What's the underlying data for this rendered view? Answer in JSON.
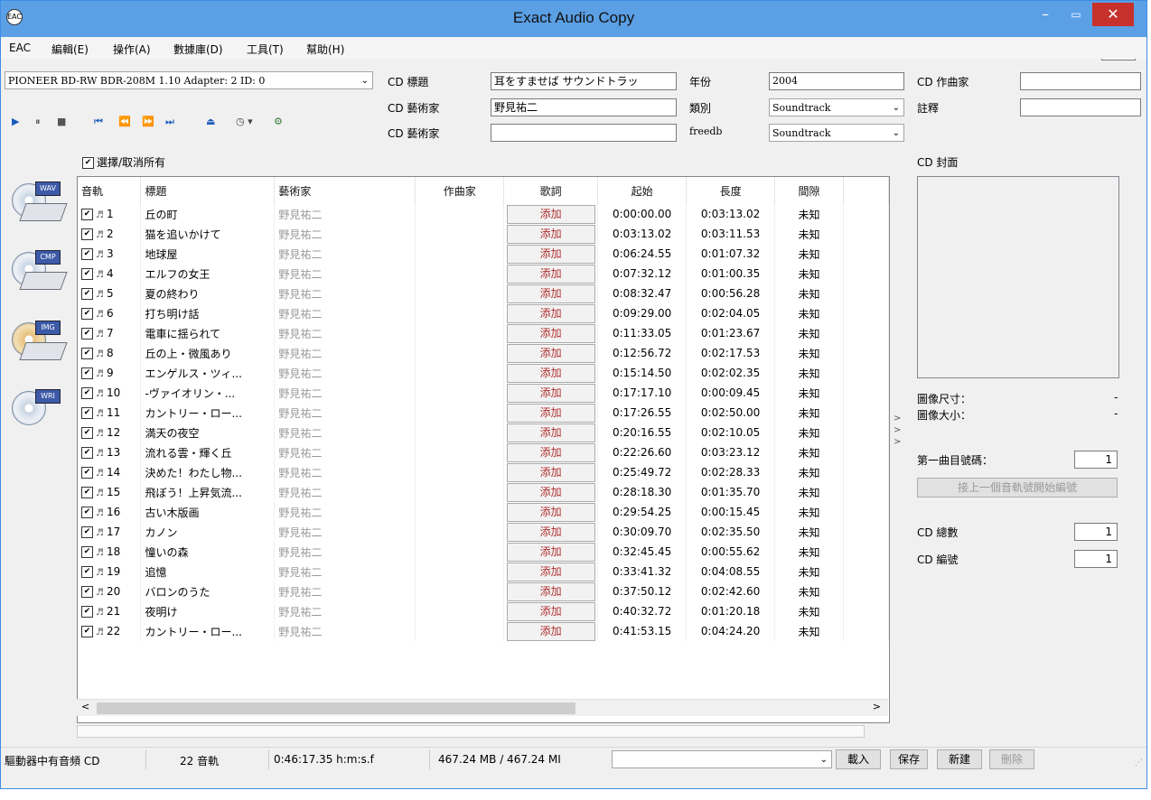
{
  "window": {
    "title": "Exact Audio Copy",
    "app_icon": "EAC",
    "tooltip": "關閉"
  },
  "menu": [
    "EAC",
    "編輯(E)",
    "操作(A)",
    "數據庫(D)",
    "工具(T)",
    "幫助(H)"
  ],
  "drive": {
    "selected": "PIONEER BD-RW   BDR-208M 1.10  Adapter: 2  ID: 0"
  },
  "cd_info": {
    "title_label": "CD 標題",
    "title_value": "耳をすませば サウンドトラッ",
    "artist_label": "CD 藝術家",
    "artist_value": "野見祐二",
    "artist2_label": "CD 藝術家",
    "artist2_value": "",
    "year_label": "年份",
    "year_value": "2004",
    "genre_label": "類別",
    "genre_value": "Soundtrack",
    "freedb_label": "freedb",
    "freedb_value": "Soundtrack",
    "composer_label": "CD 作曲家",
    "composer_value": "",
    "comment_label": "註釋",
    "comment_value": ""
  },
  "select_all_label": "選擇/取消所有",
  "sidebar_icons": [
    "WAV",
    "CMP",
    "IMG",
    "WRI"
  ],
  "table": {
    "headers": [
      "音軌",
      "標題",
      "藝術家",
      "作曲家",
      "歌詞",
      "起始",
      "長度",
      "間隙"
    ],
    "add_label": "添加",
    "rows": [
      {
        "no": "1",
        "title": "丘の町",
        "artist": "野見祐二",
        "start": "0:00:00.00",
        "len": "0:03:13.02",
        "gap": "未知"
      },
      {
        "no": "2",
        "title": "猫を追いかけて",
        "artist": "野見祐二",
        "start": "0:03:13.02",
        "len": "0:03:11.53",
        "gap": "未知"
      },
      {
        "no": "3",
        "title": "地球屋",
        "artist": "野見祐二",
        "start": "0:06:24.55",
        "len": "0:01:07.32",
        "gap": "未知"
      },
      {
        "no": "4",
        "title": "エルフの女王",
        "artist": "野見祐二",
        "start": "0:07:32.12",
        "len": "0:01:00.35",
        "gap": "未知"
      },
      {
        "no": "5",
        "title": "夏の終わり",
        "artist": "野見祐二",
        "start": "0:08:32.47",
        "len": "0:00:56.28",
        "gap": "未知"
      },
      {
        "no": "6",
        "title": "打ち明け話",
        "artist": "野見祐二",
        "start": "0:09:29.00",
        "len": "0:02:04.05",
        "gap": "未知"
      },
      {
        "no": "7",
        "title": "電車に揺られて",
        "artist": "野見祐二",
        "start": "0:11:33.05",
        "len": "0:01:23.67",
        "gap": "未知"
      },
      {
        "no": "8",
        "title": "丘の上・微風あり",
        "artist": "野見祐二",
        "start": "0:12:56.72",
        "len": "0:02:17.53",
        "gap": "未知"
      },
      {
        "no": "9",
        "title": "エンゲルス・ツィ...",
        "artist": "野見祐二",
        "start": "0:15:14.50",
        "len": "0:02:02.35",
        "gap": "未知"
      },
      {
        "no": "10",
        "title": "-ヴァイオリン・...",
        "artist": "野見祐二",
        "start": "0:17:17.10",
        "len": "0:00:09.45",
        "gap": "未知"
      },
      {
        "no": "11",
        "title": "カントリー・ロー...",
        "artist": "野見祐二",
        "start": "0:17:26.55",
        "len": "0:02:50.00",
        "gap": "未知"
      },
      {
        "no": "12",
        "title": "満天の夜空",
        "artist": "野見祐二",
        "start": "0:20:16.55",
        "len": "0:02:10.05",
        "gap": "未知"
      },
      {
        "no": "13",
        "title": "流れる雲・輝く丘",
        "artist": "野見祐二",
        "start": "0:22:26.60",
        "len": "0:03:23.12",
        "gap": "未知"
      },
      {
        "no": "14",
        "title": "決めた！わたし物...",
        "artist": "野見祐二",
        "start": "0:25:49.72",
        "len": "0:02:28.33",
        "gap": "未知"
      },
      {
        "no": "15",
        "title": "飛ぼう！上昇気流...",
        "artist": "野見祐二",
        "start": "0:28:18.30",
        "len": "0:01:35.70",
        "gap": "未知"
      },
      {
        "no": "16",
        "title": "古い木版画",
        "artist": "野見祐二",
        "start": "0:29:54.25",
        "len": "0:00:15.45",
        "gap": "未知"
      },
      {
        "no": "17",
        "title": "カノン",
        "artist": "野見祐二",
        "start": "0:30:09.70",
        "len": "0:02:35.50",
        "gap": "未知"
      },
      {
        "no": "18",
        "title": "憧いの森",
        "artist": "野見祐二",
        "start": "0:32:45.45",
        "len": "0:00:55.62",
        "gap": "未知"
      },
      {
        "no": "19",
        "title": "追憶",
        "artist": "野見祐二",
        "start": "0:33:41.32",
        "len": "0:04:08.55",
        "gap": "未知"
      },
      {
        "no": "20",
        "title": "バロンのうた",
        "artist": "野見祐二",
        "start": "0:37:50.12",
        "len": "0:02:42.60",
        "gap": "未知"
      },
      {
        "no": "21",
        "title": "夜明け",
        "artist": "野見祐二",
        "start": "0:40:32.72",
        "len": "0:01:20.18",
        "gap": "未知"
      },
      {
        "no": "22",
        "title": "カントリー・ロー...",
        "artist": "野見祐二",
        "start": "0:41:53.15",
        "len": "0:04:24.20",
        "gap": "未知"
      }
    ]
  },
  "right_panel": {
    "cover_label": "CD 封面",
    "image_size_label": "圖像尺寸：",
    "image_size_value": "-",
    "image_bytes_label": "圖像大小：",
    "image_bytes_value": "-",
    "first_track_label": "第一曲目號碼：",
    "first_track_value": "1",
    "continue_button": "接上一個音軌號開始編號",
    "cd_count_label": "CD 總數",
    "cd_count_value": "1",
    "cd_number_label": "CD 編號",
    "cd_number_value": "1"
  },
  "status": {
    "disc": "驅動器中有音頻 CD",
    "tracks": "22 音軌",
    "duration": "0:46:17.35 h:m:s.f",
    "size": "467.24 MB / 467.24 MI",
    "load": "載入",
    "save": "保存",
    "new": "新建",
    "delete": "刪除"
  }
}
